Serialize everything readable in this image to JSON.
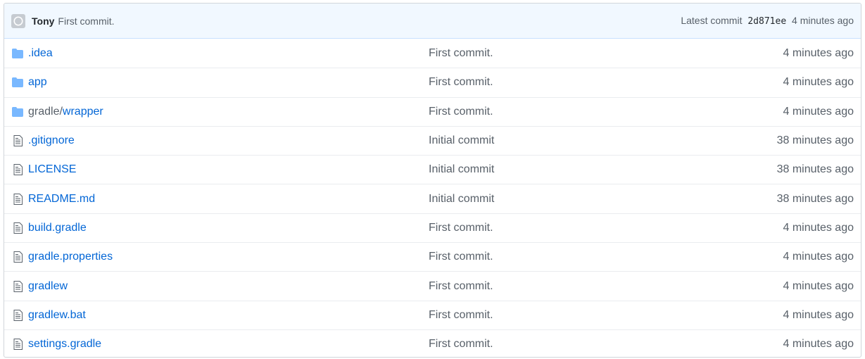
{
  "commit": {
    "author": "Tony",
    "message": "First commit.",
    "latest_label": "Latest commit",
    "sha": "2d871ee",
    "age": "4 minutes ago"
  },
  "files": [
    {
      "type": "folder",
      "prefix": "",
      "name": ".idea",
      "message": "First commit.",
      "age": "4 minutes ago"
    },
    {
      "type": "folder",
      "prefix": "",
      "name": "app",
      "message": "First commit.",
      "age": "4 minutes ago"
    },
    {
      "type": "folder",
      "prefix": "gradle/",
      "name": "wrapper",
      "message": "First commit.",
      "age": "4 minutes ago"
    },
    {
      "type": "file",
      "prefix": "",
      "name": ".gitignore",
      "message": "Initial commit",
      "age": "38 minutes ago"
    },
    {
      "type": "file",
      "prefix": "",
      "name": "LICENSE",
      "message": "Initial commit",
      "age": "38 minutes ago"
    },
    {
      "type": "file",
      "prefix": "",
      "name": "README.md",
      "message": "Initial commit",
      "age": "38 minutes ago"
    },
    {
      "type": "file",
      "prefix": "",
      "name": "build.gradle",
      "message": "First commit.",
      "age": "4 minutes ago"
    },
    {
      "type": "file",
      "prefix": "",
      "name": "gradle.properties",
      "message": "First commit.",
      "age": "4 minutes ago"
    },
    {
      "type": "file",
      "prefix": "",
      "name": "gradlew",
      "message": "First commit.",
      "age": "4 minutes ago"
    },
    {
      "type": "file",
      "prefix": "",
      "name": "gradlew.bat",
      "message": "First commit.",
      "age": "4 minutes ago"
    },
    {
      "type": "file",
      "prefix": "",
      "name": "settings.gradle",
      "message": "First commit.",
      "age": "4 minutes ago"
    }
  ],
  "icons": {
    "folder": "folder-icon",
    "file": "file-icon",
    "avatar": "github-avatar-icon"
  },
  "colors": {
    "link": "#0366d6",
    "muted": "#586069",
    "folder": "#79b8ff",
    "header_bg": "#f1f8ff"
  }
}
